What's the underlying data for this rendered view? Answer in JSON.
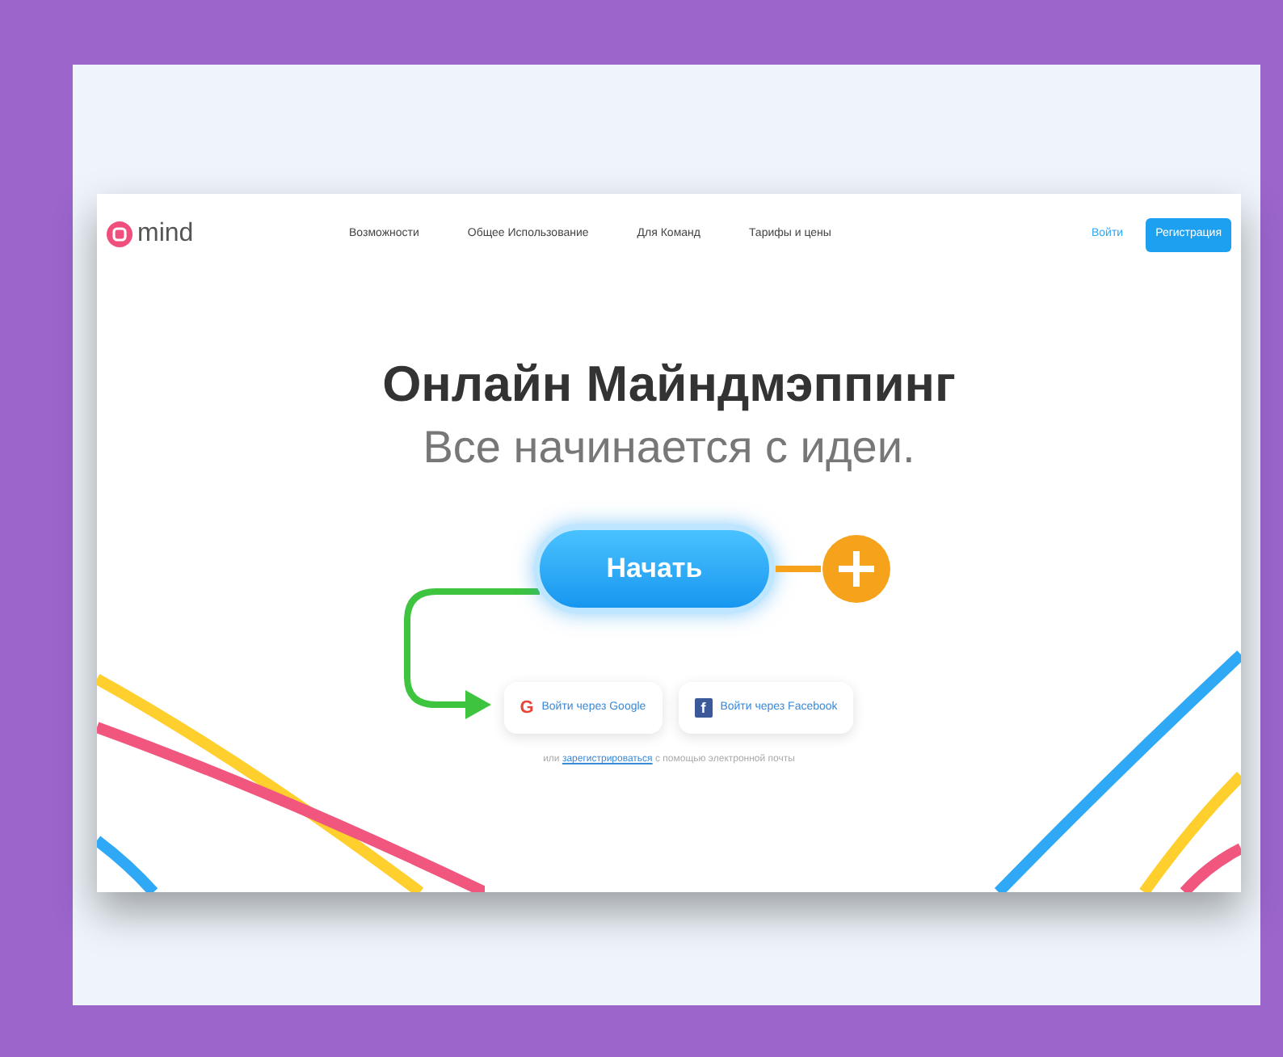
{
  "logo": {
    "text": "mind"
  },
  "nav": [
    {
      "label": "Возможности"
    },
    {
      "label": "Общее Использование"
    },
    {
      "label": "Для Команд"
    },
    {
      "label": "Тарифы и цены"
    }
  ],
  "login": {
    "label": "Войти"
  },
  "signup": {
    "label": "Регистрация"
  },
  "hero": {
    "title": "Онлайн Майндмэппинг",
    "subtitle": "Все начинается с идеи."
  },
  "start_button": {
    "label": "Начать"
  },
  "social": [
    {
      "kind": "google",
      "label": "Войти через Google",
      "icon": "G"
    },
    {
      "kind": "facebook",
      "label": "Войти через Facebook",
      "icon": "f"
    }
  ],
  "footer": {
    "before": "или",
    "link": "зарегистрироваться",
    "after": "с помощью электронной почты"
  }
}
